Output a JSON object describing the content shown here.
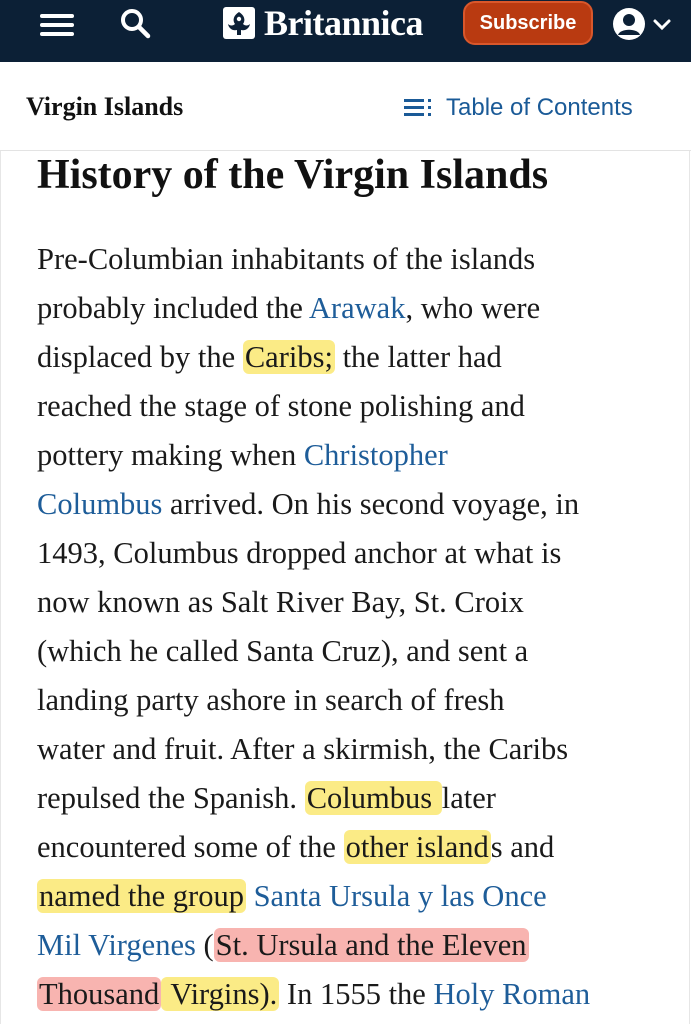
{
  "topbar": {
    "logo_text": "Britannica",
    "subscribe_label": "Subscribe",
    "colors": {
      "background": "#0c2036",
      "subscribe": "#b93a11"
    }
  },
  "subheader": {
    "title": "Virgin Islands",
    "toc_label": "Table of Contents"
  },
  "article": {
    "heading": "History of the Virgin Islands",
    "lines": [
      [
        {
          "t": "Pre-Columbian inhabitants of the islands"
        }
      ],
      [
        {
          "t": "probably included the "
        },
        {
          "t": "Arawak",
          "link": true
        },
        {
          "t": ", who were"
        }
      ],
      [
        {
          "t": "displaced by the "
        },
        {
          "t": "Caribs;",
          "hl": "yellow"
        },
        {
          "t": " the latter had"
        }
      ],
      [
        {
          "t": "reached the stage of stone polishing and"
        }
      ],
      [
        {
          "t": "pottery making when "
        },
        {
          "t": "Christopher",
          "link": true
        }
      ],
      [
        {
          "t": "Columbus",
          "link": true
        },
        {
          "t": " arrived. On his second voyage, in"
        }
      ],
      [
        {
          "t": "1493, Columbus dropped anchor at what is"
        }
      ],
      [
        {
          "t": "now known as Salt River Bay, St. Croix"
        }
      ],
      [
        {
          "t": "(which he called Santa Cruz), and sent a"
        }
      ],
      [
        {
          "t": "landing party ashore in search of fresh"
        }
      ],
      [
        {
          "t": "water and fruit. After a skirmish, the Caribs"
        }
      ],
      [
        {
          "t": "repulsed the Spanish. "
        },
        {
          "t": "Columbus ",
          "hl": "yellow"
        },
        {
          "t": "later"
        }
      ],
      [
        {
          "t": "encountered some of the "
        },
        {
          "t": "other island",
          "hl": "yellow"
        },
        {
          "t": "s and"
        }
      ],
      [
        {
          "t": "named the group",
          "hl": "yellow"
        },
        {
          "t": " "
        },
        {
          "t": "Santa Ursula y las Once",
          "link": true
        }
      ],
      [
        {
          "t": "Mil Virgenes",
          "link": true
        },
        {
          "t": " ("
        },
        {
          "t": "St. Ursula and the Eleven",
          "hl": "red"
        }
      ],
      [
        {
          "t": "Thousand",
          "hl": "red"
        },
        {
          "t": " Virgins).",
          "hl": "yellow"
        },
        {
          "t": " In 1555 the "
        },
        {
          "t": "Holy Roman",
          "link": true
        }
      ]
    ]
  },
  "highlight_colors": {
    "yellow": "#fbeb86",
    "red": "#f8b4b0",
    "link": "#1e5d99"
  }
}
